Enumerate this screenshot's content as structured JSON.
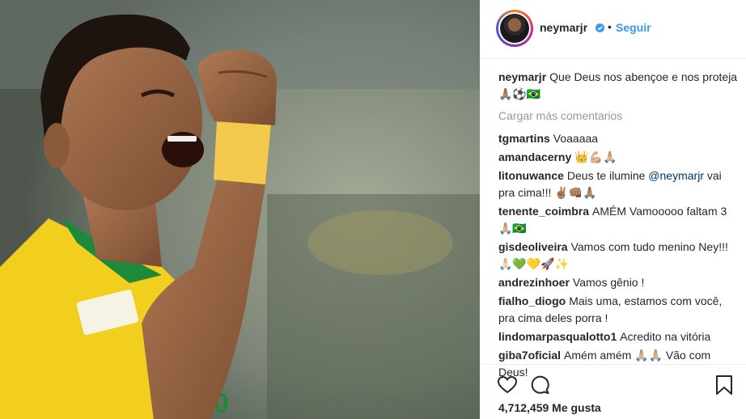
{
  "post": {
    "username": "neymarjr",
    "separator": "•",
    "follow_label": "Seguir",
    "caption_user": "neymarjr",
    "caption_text": "Que Deus nos abençoe e nos proteja 🙏🏽⚽🇧🇷",
    "load_more": "Cargar más comentarios",
    "likes": "4,712,459 Me gusta"
  },
  "comments": [
    {
      "user": "tgmartins",
      "text": "Voaaaaa"
    },
    {
      "user": "amandacerny",
      "text": "👑💪🏼🙏🏼"
    },
    {
      "user": "litonuwance",
      "pre": "Deus te ilumine ",
      "mention": "@neymarjr",
      "post": " vai pra cima!!! ✌🏽👊🏽🙏🏽"
    },
    {
      "user": "tenente_coimbra",
      "text": "AMÉM Vamooooo faltam 3 🙏🏼🇧🇷"
    },
    {
      "user": "gisdeoliveira",
      "text": "Vamos com tudo menino Ney!!! 🙏🏻💚💛🚀✨"
    },
    {
      "user": "andrezinhoer",
      "text": "Vamos gênio !"
    },
    {
      "user": "fialho_diogo",
      "text": "Mais uma, estamos com você, pra cima deles porra !"
    },
    {
      "user": "lindomarpasqualotto1",
      "text": "Acredito na vitória"
    },
    {
      "user": "giba7oficial",
      "text": "Amém amém 🙏🏼🙏🏼 Vão com Deus!"
    }
  ],
  "colors": {
    "link": "#3897f0",
    "mention": "#003569",
    "jersey_yellow": "#f2cf1f",
    "jersey_green": "#1c8a3a"
  },
  "icons": [
    "verified-badge-icon",
    "heart-icon",
    "comment-icon",
    "bookmark-icon"
  ]
}
